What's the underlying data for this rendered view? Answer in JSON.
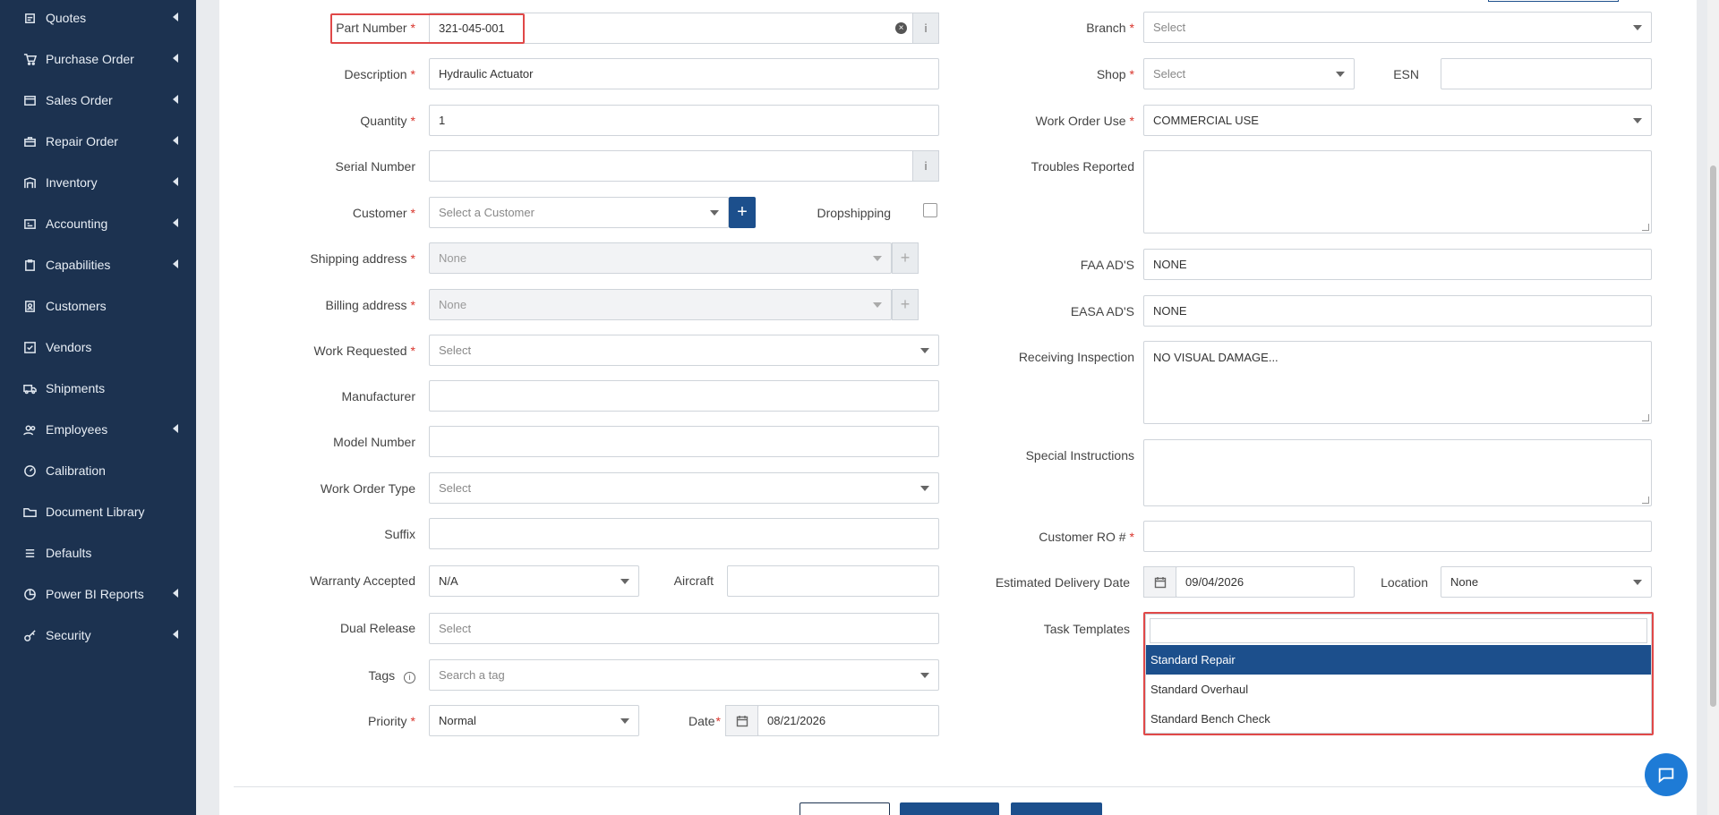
{
  "sidebar": {
    "items": [
      {
        "label": "Quotes",
        "icon": "quote-icon",
        "has_children": true
      },
      {
        "label": "Purchase Order",
        "icon": "cart-icon",
        "has_children": true
      },
      {
        "label": "Sales Order",
        "icon": "card-icon",
        "has_children": true
      },
      {
        "label": "Repair Order",
        "icon": "toolbox-icon",
        "has_children": true
      },
      {
        "label": "Inventory",
        "icon": "warehouse-icon",
        "has_children": true
      },
      {
        "label": "Accounting",
        "icon": "ledger-icon",
        "has_children": true
      },
      {
        "label": "Capabilities",
        "icon": "clipboard-icon",
        "has_children": true
      },
      {
        "label": "Customers",
        "icon": "address-book-icon",
        "has_children": false
      },
      {
        "label": "Vendors",
        "icon": "check-square-icon",
        "has_children": false
      },
      {
        "label": "Shipments",
        "icon": "truck-icon",
        "has_children": false
      },
      {
        "label": "Employees",
        "icon": "users-icon",
        "has_children": true
      },
      {
        "label": "Calibration",
        "icon": "gauge-icon",
        "has_children": false
      },
      {
        "label": "Document Library",
        "icon": "folder-icon",
        "has_children": false
      },
      {
        "label": "Defaults",
        "icon": "list-icon",
        "has_children": false
      },
      {
        "label": "Power BI Reports",
        "icon": "chart-icon",
        "has_children": true
      },
      {
        "label": "Security",
        "icon": "key-icon",
        "has_children": true
      }
    ]
  },
  "form": {
    "left": {
      "part_number": {
        "label": "Part Number",
        "value": "321-045-001"
      },
      "description": {
        "label": "Description",
        "value": "Hydraulic Actuator"
      },
      "quantity": {
        "label": "Quantity",
        "value": "1"
      },
      "serial_number": {
        "label": "Serial Number",
        "value": ""
      },
      "customer": {
        "label": "Customer",
        "placeholder": "Select a Customer"
      },
      "dropshipping": {
        "label": "Dropshipping",
        "checked": false
      },
      "shipping_address": {
        "label": "Shipping address",
        "value": "None"
      },
      "billing_address": {
        "label": "Billing address",
        "value": "None"
      },
      "work_requested": {
        "label": "Work Requested",
        "placeholder": "Select"
      },
      "manufacturer": {
        "label": "Manufacturer",
        "value": ""
      },
      "model_number": {
        "label": "Model Number",
        "value": ""
      },
      "work_order_type": {
        "label": "Work Order Type",
        "placeholder": "Select"
      },
      "suffix": {
        "label": "Suffix",
        "value": ""
      },
      "warranty_accepted": {
        "label": "Warranty Accepted",
        "value": "N/A"
      },
      "aircraft": {
        "label": "Aircraft",
        "value": ""
      },
      "dual_release": {
        "label": "Dual Release",
        "placeholder": "Select"
      },
      "tags": {
        "label": "Tags",
        "placeholder": "Search a tag"
      },
      "priority": {
        "label": "Priority",
        "value": "Normal"
      },
      "date": {
        "label": "Date",
        "value": "08/21/2026"
      }
    },
    "right": {
      "branch": {
        "label": "Branch",
        "placeholder": "Select"
      },
      "shop": {
        "label": "Shop",
        "placeholder": "Select"
      },
      "esn": {
        "label": "ESN",
        "value": ""
      },
      "work_order_use": {
        "label": "Work Order Use",
        "value": "COMMERCIAL USE"
      },
      "troubles_reported": {
        "label": "Troubles Reported",
        "value": ""
      },
      "faa_ads": {
        "label": "FAA AD'S",
        "value": "NONE"
      },
      "easa_ads": {
        "label": "EASA AD'S",
        "value": "NONE"
      },
      "receiving_inspection": {
        "label": "Receiving Inspection",
        "value": "NO VISUAL DAMAGE..."
      },
      "special_instructions": {
        "label": "Special Instructions",
        "value": ""
      },
      "customer_ro": {
        "label": "Customer RO #",
        "value": ""
      },
      "estimated_delivery": {
        "label": "Estimated Delivery Date",
        "value": "09/04/2026"
      },
      "location": {
        "label": "Location",
        "value": "None"
      },
      "task_templates": {
        "label": "Task Templates",
        "search_value": "",
        "options": [
          "Standard Repair",
          "Standard Overhaul",
          "Standard Bench Check"
        ],
        "highlighted": "Standard Repair"
      }
    }
  },
  "colors": {
    "sidebar_bg": "#1c3250",
    "primary": "#1c4f8c",
    "required": "#d9342b",
    "highlight_box": "#e04848"
  }
}
